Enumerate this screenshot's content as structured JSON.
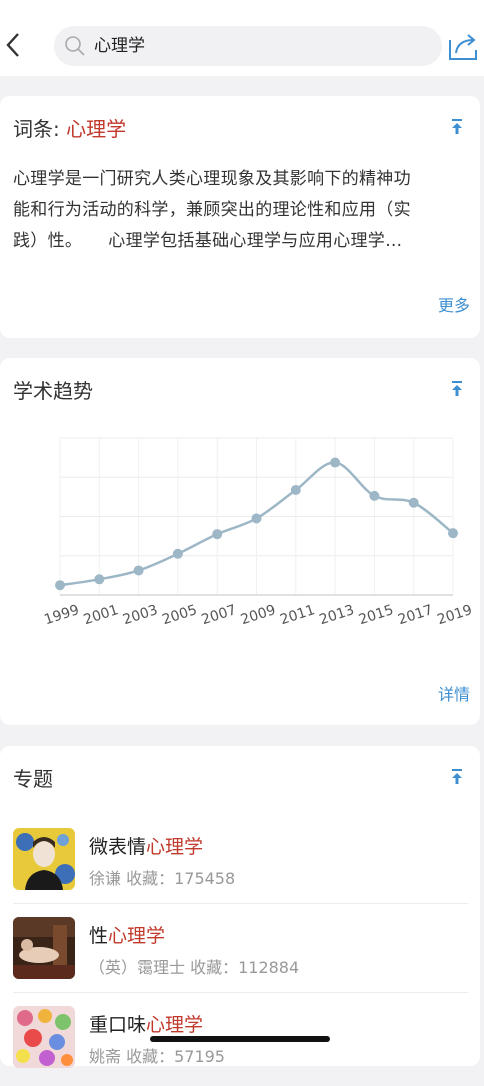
{
  "search": {
    "query": "心理学"
  },
  "entry": {
    "label": "词条:",
    "term": "心理学",
    "lines": [
      "心理学是一门研究人类心理现象及其影响下的精神功",
      "能和行为活动的科学，兼顾突出的理论性和应用（实",
      "践）性。　　心理学包括基础心理学与应用心理学…"
    ],
    "more": "更多"
  },
  "trend": {
    "title": "学术趋势",
    "detail": "详情"
  },
  "chart_data": {
    "type": "line",
    "x": [
      "1999",
      "2001",
      "2003",
      "2005",
      "2007",
      "2009",
      "2011",
      "2013",
      "2015",
      "2017",
      "2019"
    ],
    "series": [
      {
        "values": [
          10,
          16,
          25,
          42,
          62,
          78,
          107,
          135,
          101,
          94,
          63
        ]
      }
    ],
    "ylim": [
      0,
      160
    ],
    "grid": true
  },
  "topics": {
    "title": "专题",
    "items": [
      {
        "prefix": "微表情",
        "term": "心理学",
        "meta": "徐谦 收藏：175458"
      },
      {
        "prefix": "性",
        "term": "心理学",
        "meta": "（英）霭理士 收藏：112884"
      },
      {
        "prefix": "重口味",
        "term": "心理学",
        "meta": "姚斋 收藏：57195"
      }
    ]
  },
  "colors": {
    "accent": "#3d8fd1",
    "highlight": "#c0392b",
    "line": "#9db7c7"
  }
}
